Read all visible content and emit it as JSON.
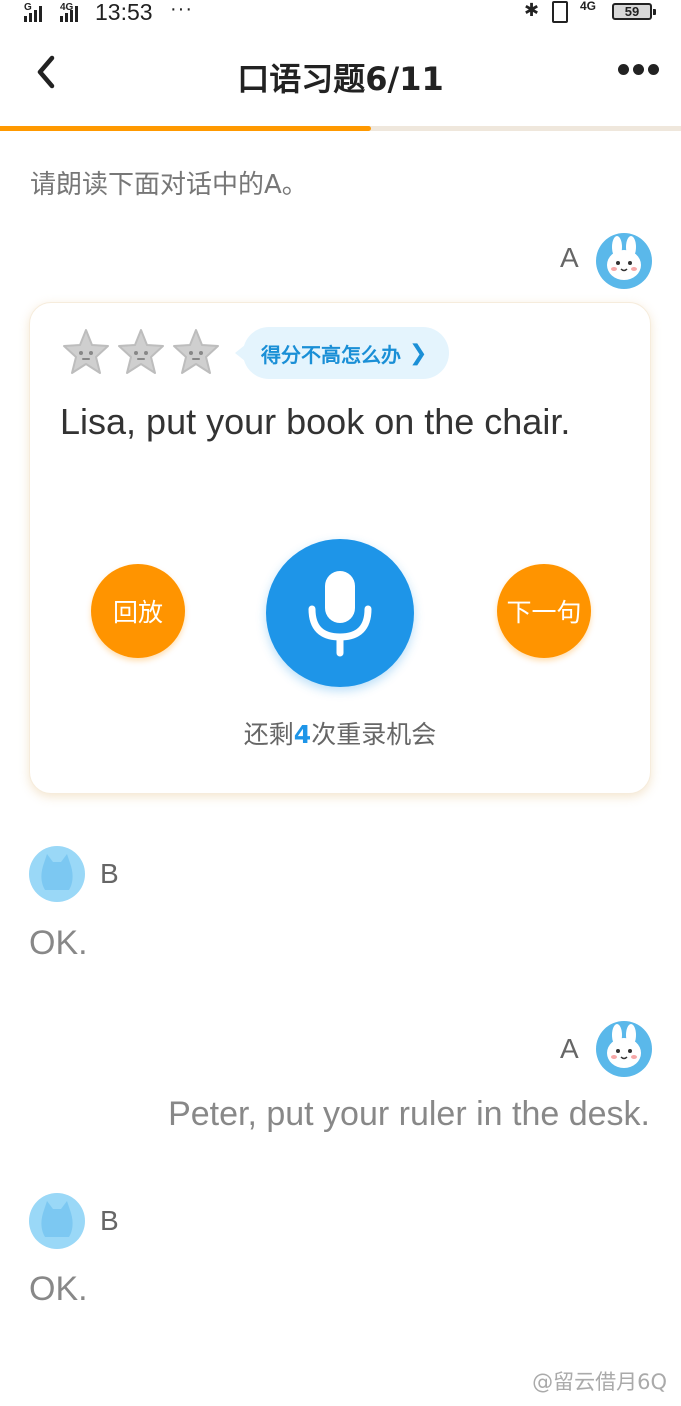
{
  "status_bar": {
    "signal1_label": "G",
    "signal2_label": "4G",
    "time": "13:53",
    "more": "···",
    "network_right": "4G",
    "battery": "59"
  },
  "header": {
    "title": "口语习题6/11",
    "progress_fraction": 0.545
  },
  "instruction": "请朗读下面对话中的A。",
  "dialog": {
    "current": {
      "role": "A",
      "stars_earned": 0,
      "stars_total": 3,
      "tip": "得分不高怎么办",
      "sentence": "Lisa, put your book on the chair.",
      "replay_label": "回放",
      "next_label": "下一句",
      "remaining_prefix": "还剩",
      "remaining_count": "4",
      "remaining_suffix": "次重录机会"
    },
    "line2": {
      "role": "B",
      "text": "OK."
    },
    "line3": {
      "role": "A",
      "text": "Peter, put your ruler in the desk."
    },
    "line4": {
      "role": "B",
      "text": "OK."
    }
  },
  "watermark": "@留云借月6Q",
  "colors": {
    "accent_orange": "#ff9400",
    "accent_blue": "#1e95e8"
  }
}
